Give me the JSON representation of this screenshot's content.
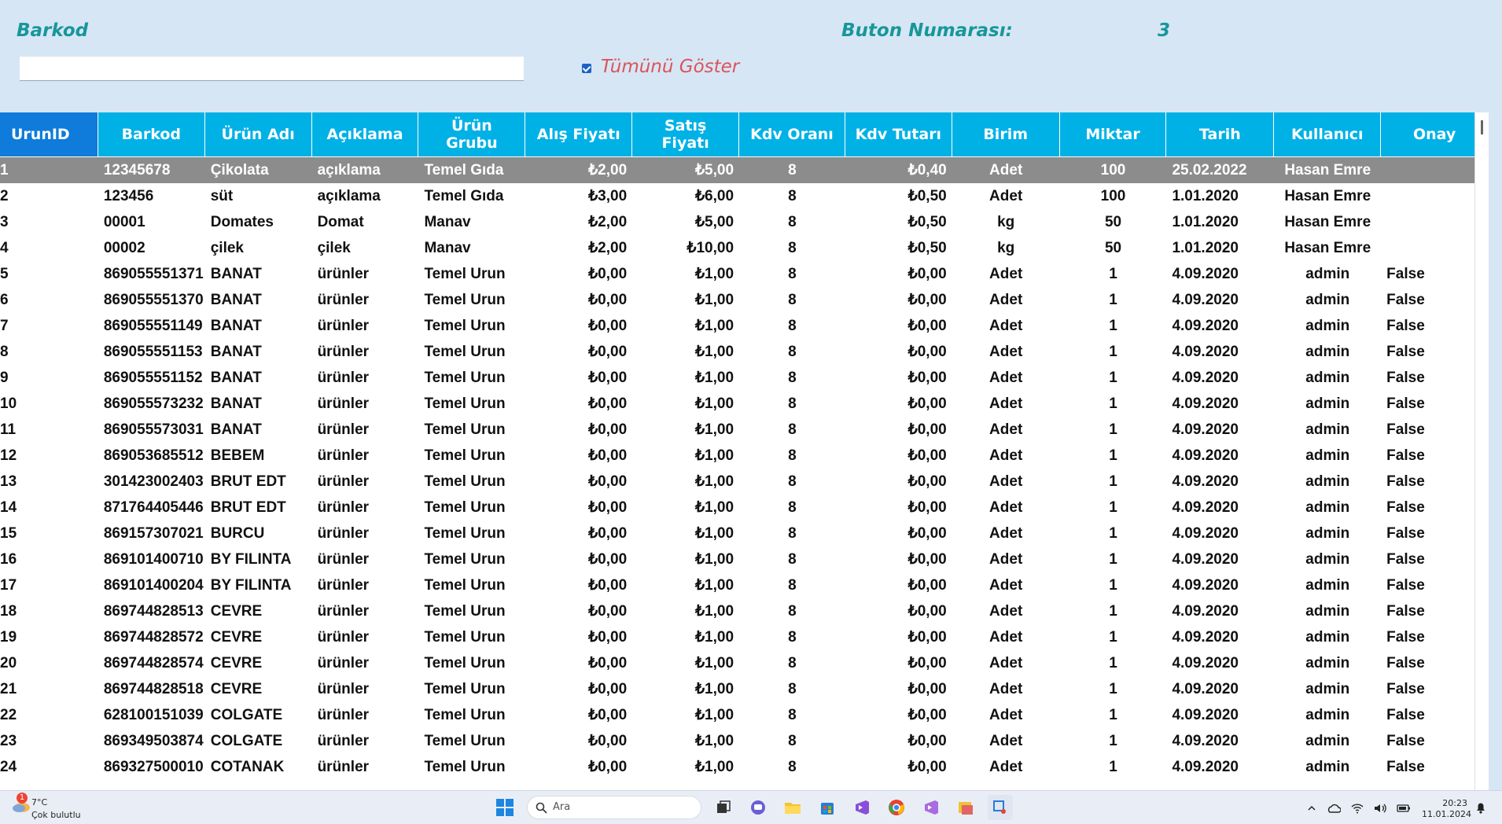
{
  "form": {
    "barkod_label": "Barkod",
    "buton_label": "Buton Numarası:",
    "buton_value": "3",
    "barkod_input_value": "",
    "checkbox_label": "Tümünü Göster",
    "checkbox_checked": true
  },
  "grid": {
    "columns": [
      "UrunID",
      "Barkod",
      "Ürün Adı",
      "Açıklama",
      "Ürün\nGrubu",
      "Alış Fiyatı",
      "Satış\nFiyatı",
      "Kdv Oranı",
      "Kdv Tutarı",
      "Birim",
      "Miktar",
      "Tarih",
      "Kullanıcı",
      "Onay"
    ],
    "rows": [
      [
        "1",
        "12345678",
        "Çikolata",
        "açıklama",
        "Temel Gıda",
        "₺2,00",
        "₺5,00",
        "8",
        "₺0,40",
        "Adet",
        "100",
        "25.02.2022",
        "Hasan Emre",
        ""
      ],
      [
        "2",
        "123456",
        "süt",
        "açıklama",
        "Temel Gıda",
        "₺3,00",
        "₺6,00",
        "8",
        "₺0,50",
        "Adet",
        "100",
        "1.01.2020",
        "Hasan Emre",
        ""
      ],
      [
        "3",
        "00001",
        "Domates",
        "Domat",
        "Manav",
        "₺2,00",
        "₺5,00",
        "8",
        "₺0,50",
        "kg",
        "50",
        "1.01.2020",
        "Hasan Emre",
        ""
      ],
      [
        "4",
        "00002",
        "çilek",
        "çilek",
        "Manav",
        "₺2,00",
        "₺10,00",
        "8",
        "₺0,50",
        "kg",
        "50",
        "1.01.2020",
        "Hasan Emre",
        ""
      ],
      [
        "5",
        "869055551371",
        "BANAT",
        "ürünler",
        "Temel Urun",
        "₺0,00",
        "₺1,00",
        "8",
        "₺0,00",
        "Adet",
        "1",
        "4.09.2020",
        "admin",
        "False"
      ],
      [
        "6",
        "869055551370",
        "BANAT",
        "ürünler",
        "Temel Urun",
        "₺0,00",
        "₺1,00",
        "8",
        "₺0,00",
        "Adet",
        "1",
        "4.09.2020",
        "admin",
        "False"
      ],
      [
        "7",
        "869055551149",
        "BANAT",
        "ürünler",
        "Temel Urun",
        "₺0,00",
        "₺1,00",
        "8",
        "₺0,00",
        "Adet",
        "1",
        "4.09.2020",
        "admin",
        "False"
      ],
      [
        "8",
        "869055551153",
        "BANAT",
        "ürünler",
        "Temel Urun",
        "₺0,00",
        "₺1,00",
        "8",
        "₺0,00",
        "Adet",
        "1",
        "4.09.2020",
        "admin",
        "False"
      ],
      [
        "9",
        "869055551152",
        "BANAT",
        "ürünler",
        "Temel Urun",
        "₺0,00",
        "₺1,00",
        "8",
        "₺0,00",
        "Adet",
        "1",
        "4.09.2020",
        "admin",
        "False"
      ],
      [
        "10",
        "869055573232",
        "BANAT",
        "ürünler",
        "Temel Urun",
        "₺0,00",
        "₺1,00",
        "8",
        "₺0,00",
        "Adet",
        "1",
        "4.09.2020",
        "admin",
        "False"
      ],
      [
        "11",
        "869055573031",
        "BANAT",
        "ürünler",
        "Temel Urun",
        "₺0,00",
        "₺1,00",
        "8",
        "₺0,00",
        "Adet",
        "1",
        "4.09.2020",
        "admin",
        "False"
      ],
      [
        "12",
        "869053685512",
        "BEBEM",
        "ürünler",
        "Temel Urun",
        "₺0,00",
        "₺1,00",
        "8",
        "₺0,00",
        "Adet",
        "1",
        "4.09.2020",
        "admin",
        "False"
      ],
      [
        "13",
        "301423002403",
        "BRUT EDT",
        "ürünler",
        "Temel Urun",
        "₺0,00",
        "₺1,00",
        "8",
        "₺0,00",
        "Adet",
        "1",
        "4.09.2020",
        "admin",
        "False"
      ],
      [
        "14",
        "871764405446",
        "BRUT EDT",
        "ürünler",
        "Temel Urun",
        "₺0,00",
        "₺1,00",
        "8",
        "₺0,00",
        "Adet",
        "1",
        "4.09.2020",
        "admin",
        "False"
      ],
      [
        "15",
        "869157307021",
        "BURCU",
        "ürünler",
        "Temel Urun",
        "₺0,00",
        "₺1,00",
        "8",
        "₺0,00",
        "Adet",
        "1",
        "4.09.2020",
        "admin",
        "False"
      ],
      [
        "16",
        "869101400710",
        "BY FILINTA",
        "ürünler",
        "Temel Urun",
        "₺0,00",
        "₺1,00",
        "8",
        "₺0,00",
        "Adet",
        "1",
        "4.09.2020",
        "admin",
        "False"
      ],
      [
        "17",
        "869101400204",
        "BY FILINTA",
        "ürünler",
        "Temel Urun",
        "₺0,00",
        "₺1,00",
        "8",
        "₺0,00",
        "Adet",
        "1",
        "4.09.2020",
        "admin",
        "False"
      ],
      [
        "18",
        "869744828513",
        "CEVRE",
        "ürünler",
        "Temel Urun",
        "₺0,00",
        "₺1,00",
        "8",
        "₺0,00",
        "Adet",
        "1",
        "4.09.2020",
        "admin",
        "False"
      ],
      [
        "19",
        "869744828572",
        "CEVRE",
        "ürünler",
        "Temel Urun",
        "₺0,00",
        "₺1,00",
        "8",
        "₺0,00",
        "Adet",
        "1",
        "4.09.2020",
        "admin",
        "False"
      ],
      [
        "20",
        "869744828574",
        "CEVRE",
        "ürünler",
        "Temel Urun",
        "₺0,00",
        "₺1,00",
        "8",
        "₺0,00",
        "Adet",
        "1",
        "4.09.2020",
        "admin",
        "False"
      ],
      [
        "21",
        "869744828518",
        "CEVRE",
        "ürünler",
        "Temel Urun",
        "₺0,00",
        "₺1,00",
        "8",
        "₺0,00",
        "Adet",
        "1",
        "4.09.2020",
        "admin",
        "False"
      ],
      [
        "22",
        "628100151039",
        "COLGATE",
        "ürünler",
        "Temel Urun",
        "₺0,00",
        "₺1,00",
        "8",
        "₺0,00",
        "Adet",
        "1",
        "4.09.2020",
        "admin",
        "False"
      ],
      [
        "23",
        "869349503874",
        "COLGATE",
        "ürünler",
        "Temel Urun",
        "₺0,00",
        "₺1,00",
        "8",
        "₺0,00",
        "Adet",
        "1",
        "4.09.2020",
        "admin",
        "False"
      ],
      [
        "24",
        "869327500010",
        "COTANAK",
        "ürünler",
        "Temel Urun",
        "₺0,00",
        "₺1,00",
        "8",
        "₺0,00",
        "Adet",
        "1",
        "4.09.2020",
        "admin",
        "False"
      ]
    ]
  },
  "taskbar": {
    "weather_temp": "7°C",
    "weather_condition": "Çok bulutlu",
    "weather_badge": "1",
    "search_placeholder": "Ara",
    "time": "20:23",
    "date": "11.01.2024"
  },
  "colors": {
    "background": "#d7e6f4",
    "header": "#00b1e6",
    "header_first": "#0f7bdb",
    "selected_row": "#8c8c8c",
    "label_teal": "#17979a",
    "label_red": "#d9555a"
  }
}
